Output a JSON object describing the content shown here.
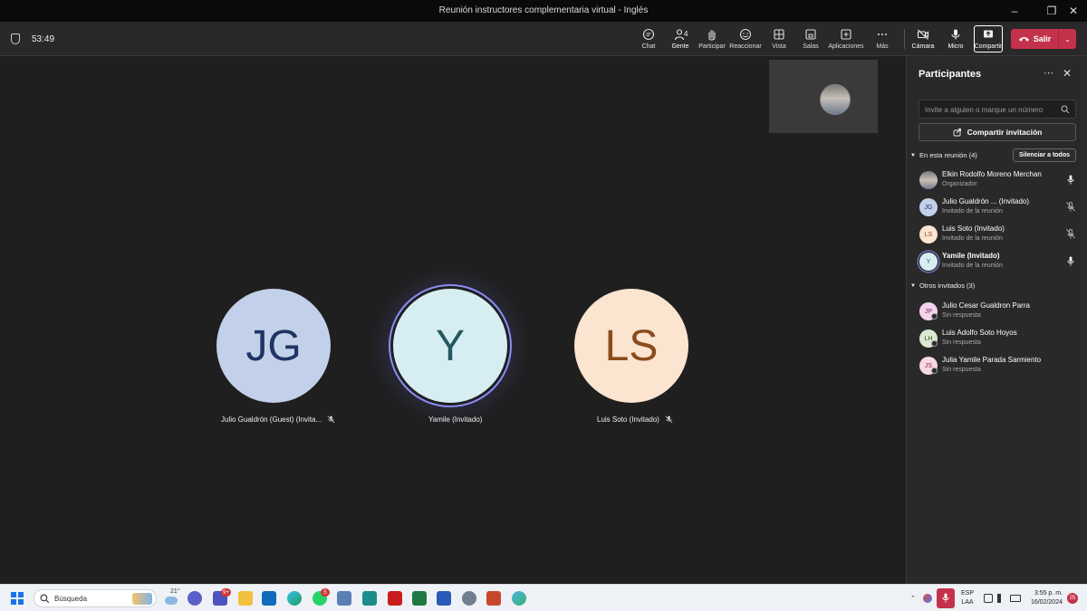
{
  "window": {
    "title": "Reunión instructores complementaria virtual - Inglés"
  },
  "toolbar": {
    "timer": "53:49",
    "buttons": [
      {
        "label": "Chat",
        "icon": "chat-icon"
      },
      {
        "label": "Gente",
        "icon": "people-icon",
        "count": "4"
      },
      {
        "label": "Participar",
        "icon": "raise-hand-icon"
      },
      {
        "label": "Reaccionar",
        "icon": "emoji-icon"
      },
      {
        "label": "Vista",
        "icon": "grid-icon"
      },
      {
        "label": "Salas",
        "icon": "rooms-icon"
      },
      {
        "label": "Aplicaciones",
        "icon": "apps-plus-icon"
      },
      {
        "label": "Más",
        "icon": "more-icon"
      },
      {
        "label": "Cámara",
        "icon": "camera-off-icon"
      },
      {
        "label": "Micro",
        "icon": "microphone-icon"
      },
      {
        "label": "Compartir",
        "icon": "share-screen-icon"
      }
    ],
    "leave_label": "Salir",
    "accent": "#8b8cf5",
    "leave_color": "#c4314b"
  },
  "stage": {
    "tiles": [
      {
        "initials": "JG",
        "name": "Julio Gualdrón (Guest) (Invita...",
        "muted": true
      },
      {
        "initials": "Y",
        "name": "Yamile (Invitado)",
        "muted": false,
        "speaking": true
      },
      {
        "initials": "LS",
        "name": "Luis Soto (Invitado)",
        "muted": true
      }
    ]
  },
  "panel": {
    "title": "Participantes",
    "invite_placeholder": "Invite a alguien o marque un número",
    "share_invite_label": "Compartir invitación",
    "in_meeting_header": "En esta reunión (4)",
    "mute_all_label": "Silenciar a todos",
    "in_meeting": [
      {
        "initials": "",
        "name": "Elkin Rodolfo Moreno Merchan",
        "role": "Organizador",
        "mic": "on"
      },
      {
        "initials": "JG",
        "name": "Julio Gualdrón ... (Invitado)",
        "role": "Invitado de la reunión",
        "mic": "off"
      },
      {
        "initials": "LS",
        "name": "Luis Soto (Invitado)",
        "role": "Invitado de la reunión",
        "mic": "off"
      },
      {
        "initials": "Y",
        "name": "Yamile (Invitado)",
        "role": "Invitado de la reunión",
        "mic": "on"
      }
    ],
    "others_header": "Otros invitados (3)",
    "others": [
      {
        "initials": "JP",
        "name": "Julio Cesar Gualdron Parra",
        "role": "Sin respuesta"
      },
      {
        "initials": "LH",
        "name": "Luis Adolfo Soto Hoyos",
        "role": "Sin respuesta"
      },
      {
        "initials": "JS",
        "name": "Julia Yamile Parada Sarmiento",
        "role": "Sin respuesta"
      }
    ]
  },
  "taskbar": {
    "search_placeholder": "Búsqueda",
    "weather_temp": "21°",
    "teams_badge": "9+",
    "whatsapp_badge": "5",
    "lang_line1": "ESP",
    "lang_line2": "LAA",
    "time": "3:55 p. m.",
    "date": "16/02/2024",
    "notifications": "25"
  }
}
